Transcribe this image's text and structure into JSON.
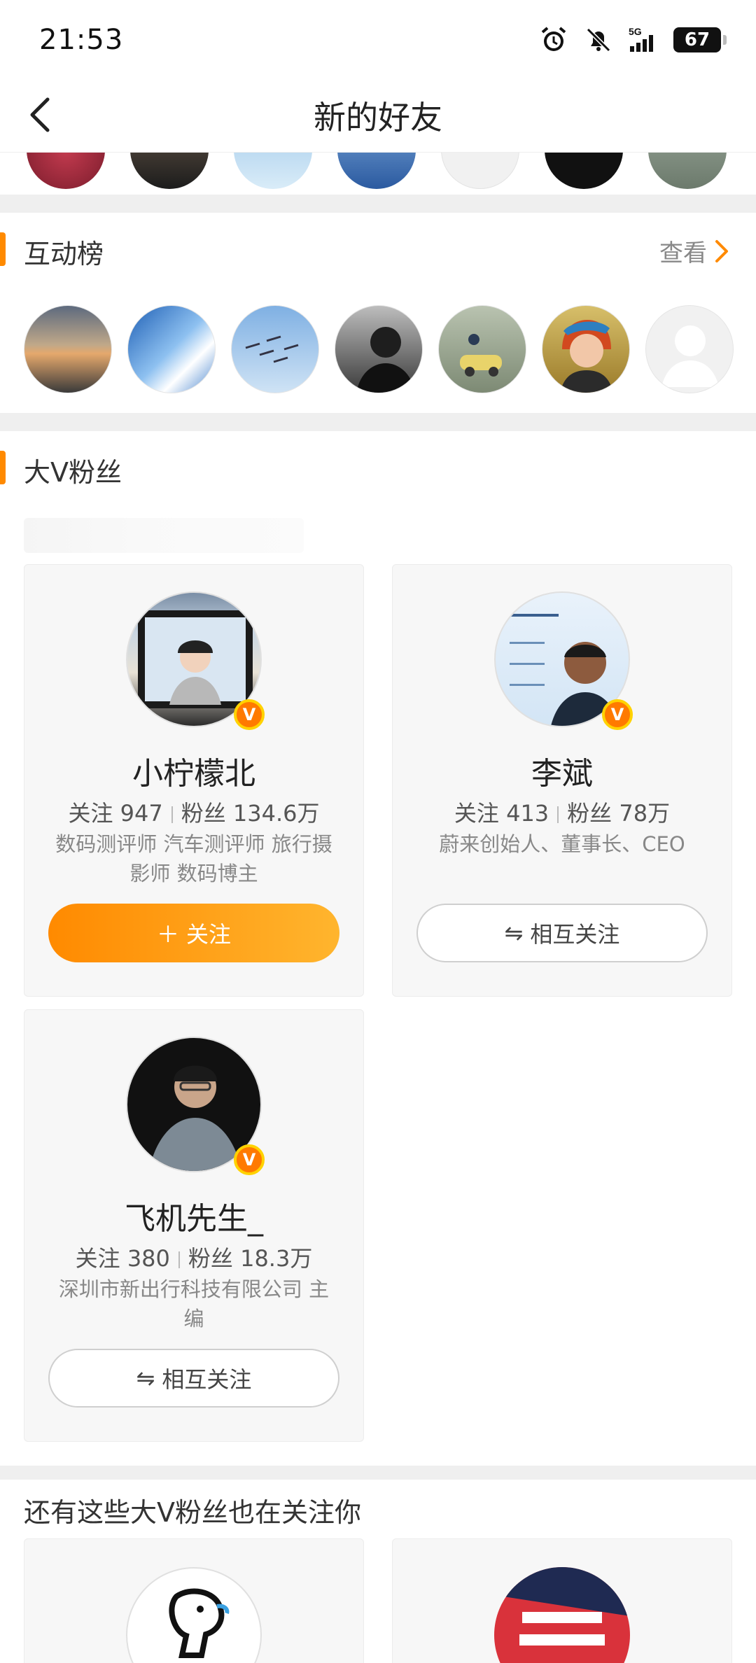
{
  "status_bar": {
    "time": "21:53",
    "battery": "67"
  },
  "nav": {
    "title": "新的好友"
  },
  "interaction_ranking": {
    "title": "互动榜",
    "more_label": "查看"
  },
  "big_v_fans": {
    "title": "大V粉丝",
    "cards": [
      {
        "name": "小柠檬北",
        "stats_follow": "关注 947",
        "stats_fans": "粉丝 134.6万",
        "desc": "数码测评师 汽车测评师 旅行摄影师 数码博主",
        "button_icon": "＋",
        "button_label": "关注",
        "verified": true
      },
      {
        "name": "李斌",
        "stats_follow": "关注 413",
        "stats_fans": "粉丝 78万",
        "desc": "蔚来创始人、董事长、CEO",
        "button_icon": "⇋",
        "button_label": "相互关注",
        "verified": true
      },
      {
        "name": "飞机先生_",
        "stats_follow": "关注 380",
        "stats_fans": "粉丝 18.3万",
        "desc": "深圳市新出行科技有限公司 主编",
        "button_icon": "⇋",
        "button_label": "相互关注",
        "verified": true
      }
    ]
  },
  "more_section": {
    "title": "还有这些大V粉丝也在关注你"
  },
  "colors": {
    "accent": "#ff8a00",
    "badge": "#ff7a00"
  }
}
